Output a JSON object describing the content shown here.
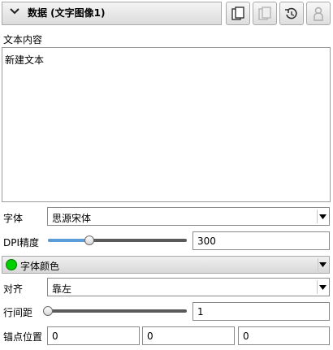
{
  "header": {
    "title": "数据 (文字图像1)",
    "chevron_icon": "chevron-down-icon",
    "toolbar_icons": [
      "copy-icon",
      "paste-icon",
      "reset-history-icon",
      "person-icon"
    ]
  },
  "text_content": {
    "label": "文本内容",
    "value": "新建文本"
  },
  "font": {
    "label": "字体",
    "selected": "思源宋体"
  },
  "dpi": {
    "label": "DPI精度",
    "value": "300",
    "slider_level": 0.3
  },
  "font_color": {
    "label": "字体颜色",
    "color": "#00d000"
  },
  "align": {
    "label": "对齐",
    "selected": "靠左"
  },
  "line_spacing": {
    "label": "行间距",
    "value": "1",
    "slider_level": 0.0
  },
  "anchor": {
    "label": "锚点位置",
    "x": "0",
    "y": "0",
    "z": "0"
  },
  "colors": {
    "accent": "#5a9bd8",
    "border": "#a9a9a9"
  }
}
